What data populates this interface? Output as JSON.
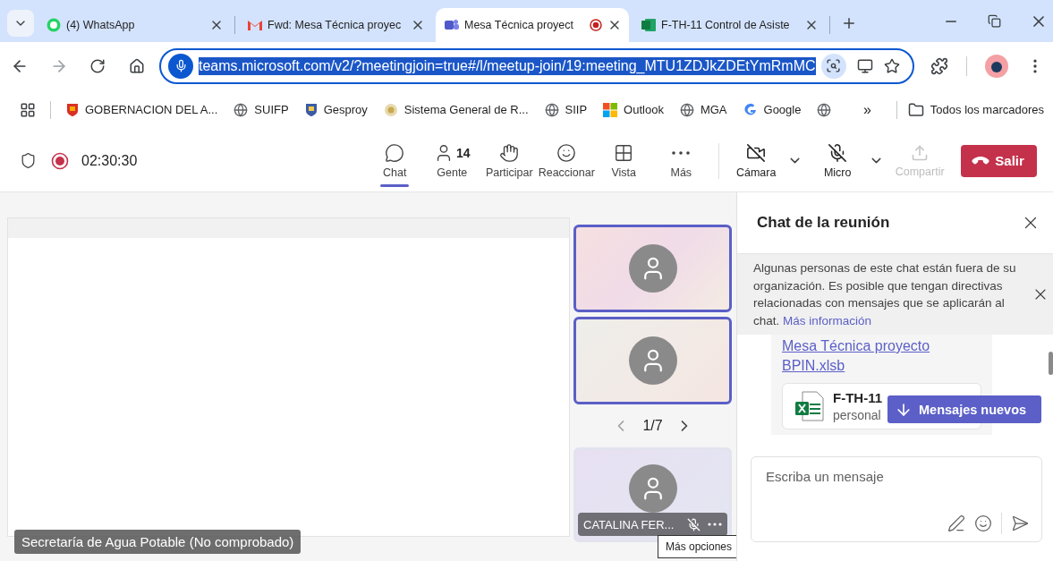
{
  "browser": {
    "tabs": [
      {
        "kind": "chat",
        "title": "(4) WhatsApp",
        "selected": false
      },
      {
        "kind": "mail",
        "title": "Fwd: Mesa Técnica proyec",
        "selected": false
      },
      {
        "kind": "meeting",
        "title": "Mesa Técnica proyect",
        "selected": true,
        "recording": true
      },
      {
        "kind": "sheet",
        "title": "F-TH-11 Control de Asiste",
        "selected": false
      }
    ],
    "url": "teams.microsoft.com/v2/?meetingjoin=true#/l/meetup-join/19:meeting_MTU1ZDJkZDEtYmRmMC",
    "bookmarks": [
      {
        "kind": "crest",
        "label": "GOBERNACION DEL A..."
      },
      {
        "kind": "globe",
        "label": "SUIFP"
      },
      {
        "kind": "shield",
        "label": "Gesproy"
      },
      {
        "kind": "seal",
        "label": "Sistema General de R..."
      },
      {
        "kind": "globe",
        "label": "SIIP"
      },
      {
        "kind": "squares",
        "label": "Outlook"
      },
      {
        "kind": "globe",
        "label": "MGA"
      },
      {
        "kind": "letter",
        "label": "Google"
      },
      {
        "kind": "globe"
      }
    ],
    "overflow": "»",
    "all_bookmarks": "Todos los marcadores"
  },
  "meeting_bar": {
    "recording": true,
    "timer": "02:30:30",
    "actions": [
      {
        "kind": "chat",
        "label": "Chat",
        "selected": true
      },
      {
        "kind": "people",
        "label": "Gente",
        "count": "14",
        "selected": false
      },
      {
        "kind": "hand",
        "label": "Participar",
        "selected": false
      },
      {
        "kind": "react",
        "label": "Reaccionar",
        "selected": false
      },
      {
        "kind": "view",
        "label": "Vista",
        "selected": false
      },
      {
        "kind": "more",
        "label": "Más",
        "selected": false
      }
    ],
    "devices": [
      {
        "kind": "camera",
        "label": "Cámara",
        "off": true
      },
      {
        "kind": "mic",
        "label": "Micro",
        "off": true
      }
    ],
    "share": {
      "label": "Compartir",
      "disabled": true
    },
    "leave": {
      "label": "Salir"
    }
  },
  "stage": {
    "share_label": "Secretaría de Agua Potable (No comprobado)",
    "tiles": [
      {
        "speaking": true
      },
      {
        "speaking": true
      }
    ],
    "pager": "1/7",
    "named_tile": {
      "name": "CATALINA FER...",
      "muted": true,
      "speaking": false
    },
    "tooltip": "Más opciones"
  },
  "chat": {
    "title": "Chat de la reunión",
    "notice": {
      "text": "Algunas personas de este chat están fuera de su organización. Es posible que tengan directivas relacionadas con mensajes que se aplicarán al chat.",
      "link": "Más información"
    },
    "message": {
      "link": "Mesa Técnica proyecto BPIN.xlsb",
      "file_name": "F-TH-11",
      "file_meta": "personal"
    },
    "new_messages": "Mensajes nuevos",
    "compose": {
      "placeholder": "Escriba un mensaje"
    }
  }
}
